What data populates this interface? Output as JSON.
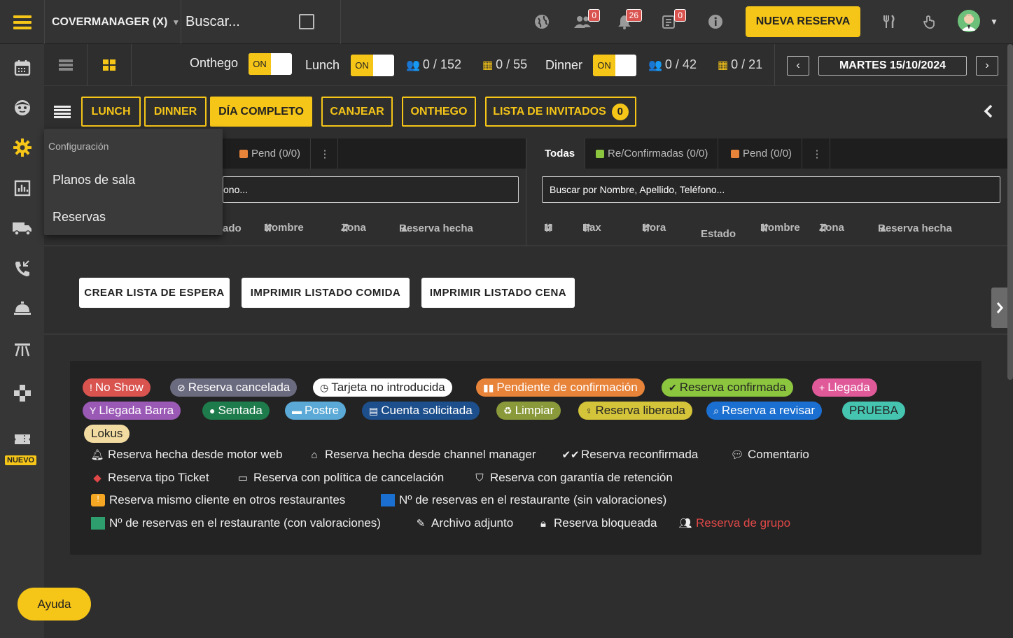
{
  "header": {
    "app_title": "COVERMANAGER (X)",
    "search_label": "Buscar...",
    "badges": {
      "users": "0",
      "bell": "26",
      "requests": "0"
    },
    "nueva_reserva": "NUEVA RESERVA"
  },
  "sidebar": {
    "nuevo_badge": "NUEVO"
  },
  "services": {
    "onthego_label": "Onthego",
    "onthego_toggle": "ON",
    "lunch_label": "Lunch",
    "lunch_toggle": "ON",
    "lunch_pax": "0 / 152",
    "lunch_tables": "0 / 55",
    "dinner_label": "Dinner",
    "dinner_toggle": "ON",
    "dinner_pax": "0 / 42",
    "dinner_tables": "0 / 21",
    "date": "MARTES 15/10/2024",
    "prev": "‹",
    "next": "›"
  },
  "filters": {
    "lunch": "LUNCH",
    "dinner": "DINNER",
    "dia_completo": "DÍA COMPLETO",
    "canjear": "CANJEAR",
    "onthego": "ONTHEGO",
    "lista_invitados": "LISTA DE INVITADOS",
    "lista_invitados_count": "0"
  },
  "dropdown": {
    "header": "Configuración",
    "items": [
      "Planos de sala",
      "Reservas"
    ]
  },
  "left_panel": {
    "tab_pend": "Pend (0/0)",
    "search_placeholder_fragment": "ono...",
    "columns": [
      "ado",
      "Nombre",
      "Zona",
      "Reserva hecha"
    ]
  },
  "right_panel": {
    "tab_todas": "Todas",
    "tab_confirmadas": "Re/Confirmadas (0/0)",
    "tab_pend": "Pend (0/0)",
    "search_placeholder": "Buscar por Nombre, Apellido, Teléfono...",
    "columns": [
      "M",
      "Pax",
      "Hora",
      "Estado",
      "Nombre",
      "Zona",
      "Reserva hecha"
    ]
  },
  "actions": {
    "crear_lista": "CREAR LISTA DE ESPERA",
    "imprimir_comida": "IMPRIMIR LISTADO COMIDA",
    "imprimir_cena": "IMPRIMIR LISTADO CENA"
  },
  "legend": {
    "chips": [
      {
        "label": "No Show",
        "color": "#d9534f",
        "icon": "!"
      },
      {
        "label": "Reserva cancelada",
        "color": "#6b6b80",
        "icon": "⊘"
      },
      {
        "label": "Tarjeta no introducida",
        "color": "#ffffff",
        "icon": "◷"
      },
      {
        "label": "Pendiente de confirmación",
        "color": "#e8833a",
        "icon": "▮▮"
      },
      {
        "label": "Reserva confirmada",
        "color": "#8cc63f",
        "icon": "✔"
      },
      {
        "label": "Llegada",
        "color": "#e05a9a",
        "icon": "+"
      },
      {
        "label": "Llegada Barra",
        "color": "#9b59b6",
        "icon": "Y"
      },
      {
        "label": "Sentada",
        "color": "#1e7b4b",
        "icon": "●"
      },
      {
        "label": "Postre",
        "color": "#5aa9d6",
        "icon": "▬"
      },
      {
        "label": "Cuenta solicitada",
        "color": "#1d4f8c",
        "icon": "▤"
      },
      {
        "label": "Limpiar",
        "color": "#8a9a3a",
        "icon": "♻"
      },
      {
        "label": "Reserva liberada",
        "color": "#d4c43a",
        "icon": "♀"
      },
      {
        "label": "Reserva a revisar",
        "color": "#1a6fd0",
        "icon": "⌕"
      },
      {
        "label": "PRUEBA",
        "color": "#45c4b0",
        "icon": ""
      },
      {
        "label": "Lokus",
        "color": "#f2dba0",
        "icon": ""
      }
    ],
    "motor_web": "Reserva hecha desde motor web",
    "channel_manager": "Reserva hecha desde channel manager",
    "reconfirmada": "Reserva reconfirmada",
    "comentario": "Comentario",
    "ticket": "Reserva tipo Ticket",
    "politica": "Reserva con política de cancelación",
    "garantia": "Reserva con garantía de retención",
    "mismo_cliente": "Reserva mismo cliente en otros restaurantes",
    "sin_valoraciones": "Nº de reservas en el restaurante (sin valoraciones)",
    "con_valoraciones": "Nº de reservas en el restaurante (con valoraciones)",
    "archivo": "Archivo adjunto",
    "bloqueada": "Reserva bloqueada",
    "grupo": "Reserva de grupo",
    "colors": {
      "accent": "#f5c518",
      "blue_square": "#1a6fd0",
      "green_square": "#2e9e6e",
      "grupo_text": "#e04848"
    }
  },
  "help": {
    "ayuda": "Ayuda"
  }
}
